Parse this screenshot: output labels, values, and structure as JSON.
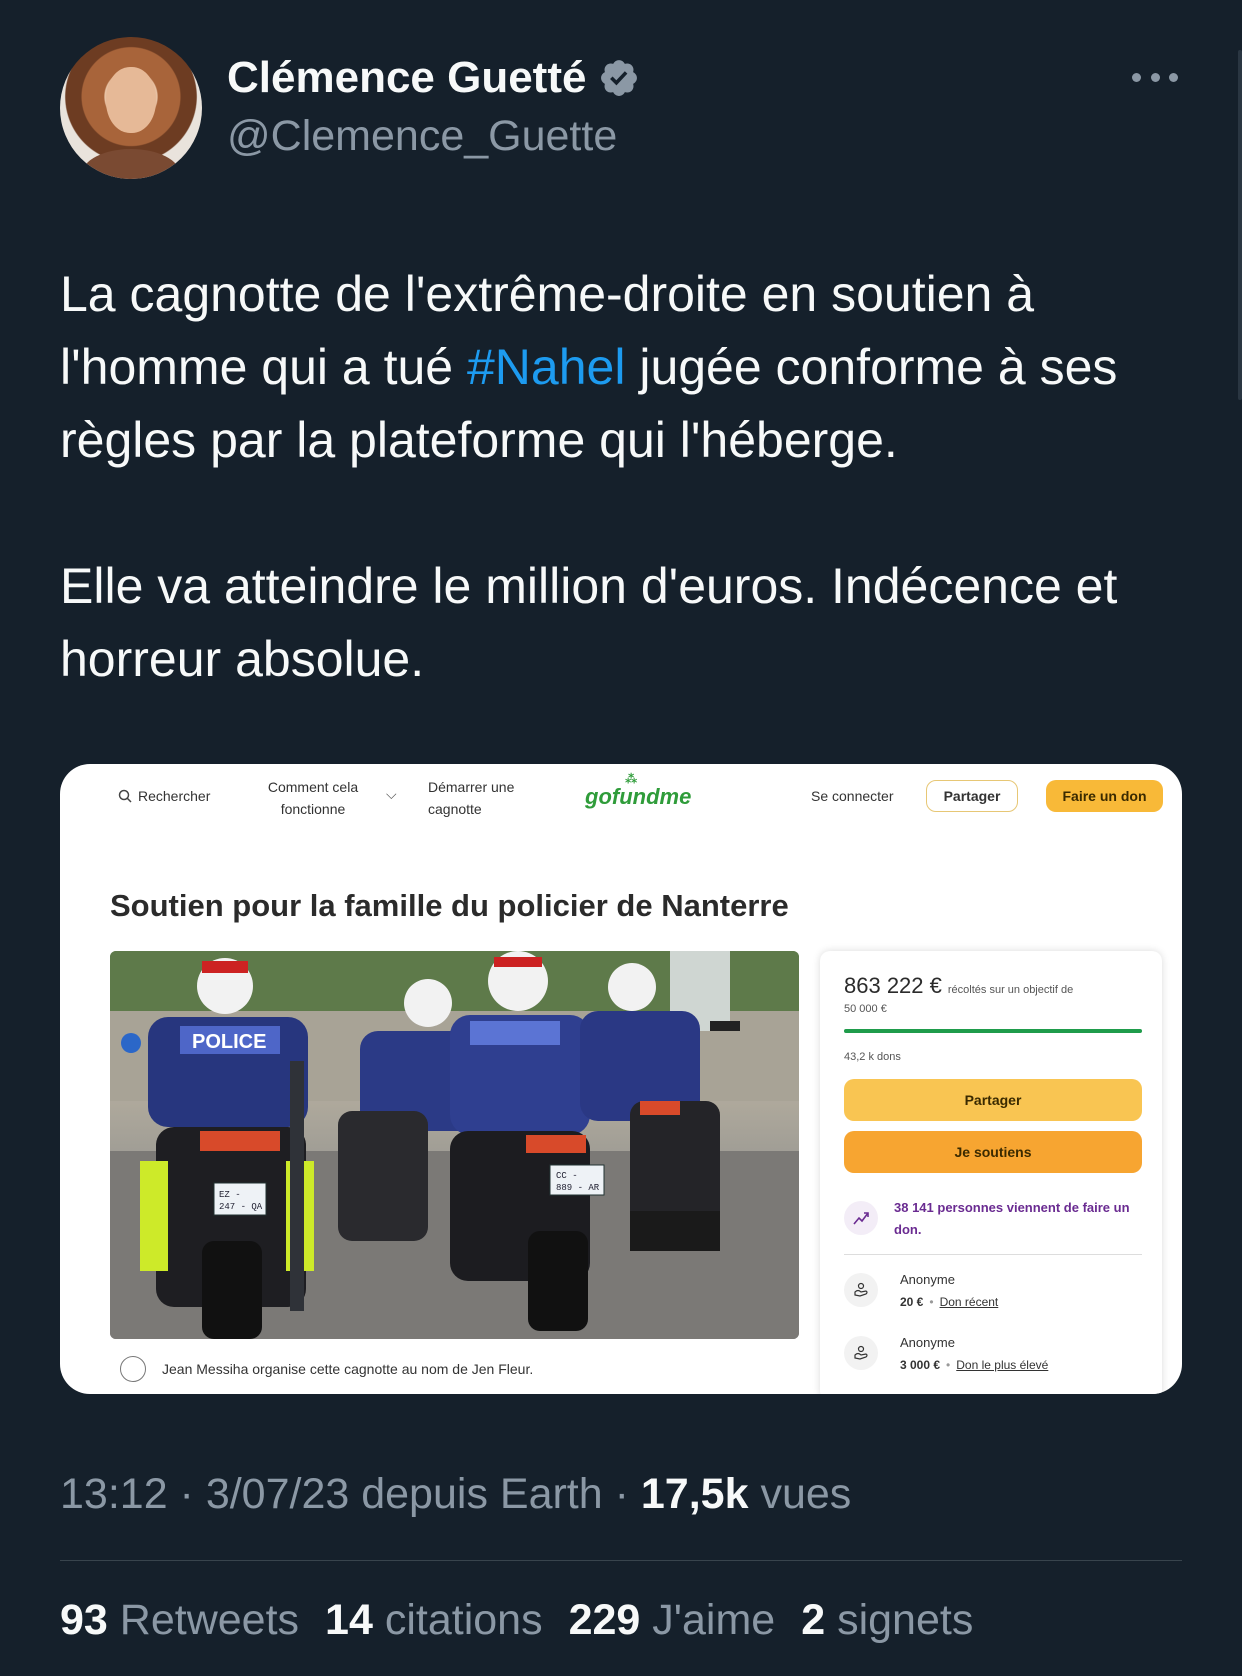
{
  "author": {
    "name": "Clémence Guetté",
    "handle": "@Clemence_Guette"
  },
  "tweet": {
    "line1_before": "La cagnotte de l'extrême-droite en soutien à l'homme qui a tué ",
    "hashtag": "#Nahel",
    "line1_after": " jugée conforme à ses règles par la plateforme qui l'héberge.",
    "paragraph2": "Elle va atteindre le million d'euros. Indécence et horreur absolue."
  },
  "gofundme": {
    "nav": {
      "search": "Rechercher",
      "how_line1": "Comment cela",
      "how_line2": "fonctionne",
      "start_line1": "Démarrer une",
      "start_line2": "cagnotte",
      "logo": "gofundme",
      "login": "Se connecter",
      "share": "Partager",
      "donate": "Faire un don"
    },
    "title": "Soutien pour la famille du policier de Nanterre",
    "photo_labels": {
      "police": "POLICE",
      "plate1": "EZ - 247 - QA",
      "plate2": "CC - 889 - AR"
    },
    "organizer": "Jean Messiha organise cette cagnotte au nom de Jen Fleur.",
    "card": {
      "amount": "863 222 €",
      "goal_text": "récoltés sur un objectif de",
      "goal_amount": "50 000 €",
      "progress_fraction": 1.0,
      "donations_count": "43,2 k dons",
      "share_button": "Partager",
      "support_button": "Je soutiens",
      "recent_text": "38 141 personnes viennent de faire un don.",
      "donors": [
        {
          "name": "Anonyme",
          "amount": "20 €",
          "tag": "Don récent"
        },
        {
          "name": "Anonyme",
          "amount": "3 000 €",
          "tag": "Don le plus élevé"
        }
      ]
    }
  },
  "meta": {
    "time": "13:12 · 3/07/23 depuis Earth · ",
    "views_count": "17,5k",
    "views_label": " vues"
  },
  "stats": [
    {
      "count": "93",
      "label": "Retweets"
    },
    {
      "count": "14",
      "label": "citations"
    },
    {
      "count": "229",
      "label": "J'aime"
    },
    {
      "count": "2",
      "label": "signets"
    }
  ],
  "colors": {
    "background": "#15202b",
    "accent": "#1d9bf0",
    "muted": "#8b98a5",
    "gofundme_green": "#2f9c3a",
    "gofundme_yellow": "#f8b938"
  }
}
